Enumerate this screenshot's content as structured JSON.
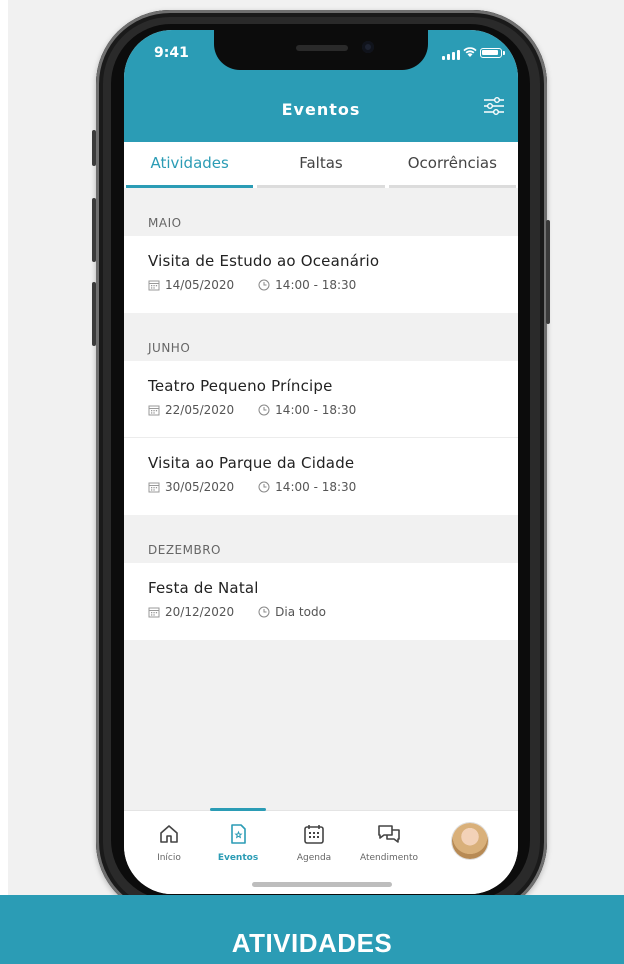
{
  "status_bar": {
    "time": "9:41"
  },
  "header": {
    "title": "Eventos"
  },
  "tabs": [
    {
      "label": "Atividades",
      "active": true
    },
    {
      "label": "Faltas",
      "active": false
    },
    {
      "label": "Ocorrências",
      "active": false
    }
  ],
  "sections": [
    {
      "month": "MAIO",
      "events": [
        {
          "title": "Visita de Estudo ao Oceanário",
          "date": "14/05/2020",
          "time": "14:00 - 18:30"
        }
      ]
    },
    {
      "month": "JUNHO",
      "events": [
        {
          "title": "Teatro Pequeno Príncipe",
          "date": "22/05/2020",
          "time": "14:00 - 18:30"
        },
        {
          "title": "Visita ao Parque da Cidade",
          "date": "30/05/2020",
          "time": "14:00 - 18:30"
        }
      ]
    },
    {
      "month": "DEZEMBRO",
      "events": [
        {
          "title": "Festa de Natal",
          "date": "20/12/2020",
          "time": "Dia todo"
        }
      ]
    }
  ],
  "tabbar": {
    "items": [
      {
        "label": "Início",
        "icon": "home-icon",
        "active": false
      },
      {
        "label": "Eventos",
        "icon": "events-icon",
        "active": true
      },
      {
        "label": "Agenda",
        "icon": "calendar-icon",
        "active": false
      },
      {
        "label": "Atendimento",
        "icon": "chat-icon",
        "active": false
      }
    ]
  },
  "banner": {
    "text": "ATIVIDADES"
  },
  "colors": {
    "accent": "#2b9cb5",
    "background": "#f1f1f1"
  }
}
